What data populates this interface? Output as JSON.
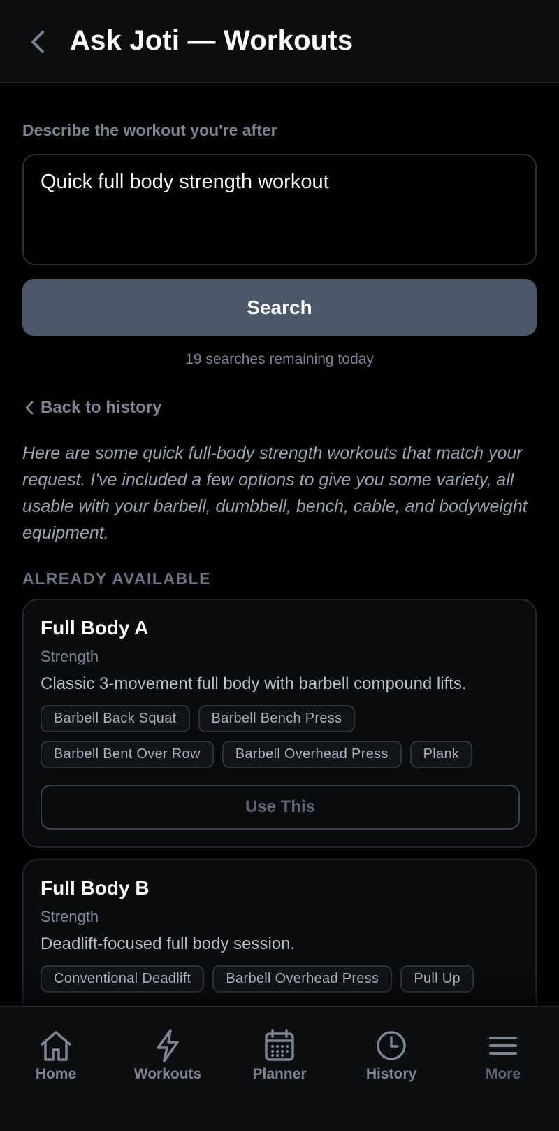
{
  "header": {
    "title": "Ask Joti — Workouts",
    "back_icon": "chevron-left-icon"
  },
  "query": {
    "label": "Describe the workout you're after",
    "value": "Quick full body strength workout"
  },
  "search": {
    "button_label": "Search",
    "remaining": "19 searches remaining today"
  },
  "back_to_history": "Back to history",
  "intro": "Here are some quick full-body strength workouts that match your request. I've included a few options to give you some variety, all usable with your barbell, dumbbell, bench, cable, and bodyweight equipment.",
  "section_label": "ALREADY AVAILABLE",
  "cards": [
    {
      "title": "Full Body A",
      "category": "Strength",
      "description": "Classic 3-movement full body with barbell compound lifts.",
      "tags": [
        "Barbell Back Squat",
        "Barbell Bench Press",
        "Barbell Bent Over Row",
        "Barbell Overhead Press",
        "Plank"
      ],
      "button_label": "Use This"
    },
    {
      "title": "Full Body B",
      "category": "Strength",
      "description": "Deadlift-focused full body session.",
      "tags": [
        "Conventional Deadlift",
        "Barbell Overhead Press",
        "Pull Up"
      ]
    }
  ],
  "tabbar": [
    {
      "label": "Home",
      "icon": "home-icon"
    },
    {
      "label": "Workouts",
      "icon": "lightning-icon"
    },
    {
      "label": "Planner",
      "icon": "calendar-icon"
    },
    {
      "label": "History",
      "icon": "clock-icon"
    },
    {
      "label": "More",
      "icon": "menu-icon"
    }
  ],
  "colors": {
    "background": "#000000",
    "accent_button": "#4b5668",
    "muted_text": "#7b8596",
    "card_border": "#22262c"
  }
}
